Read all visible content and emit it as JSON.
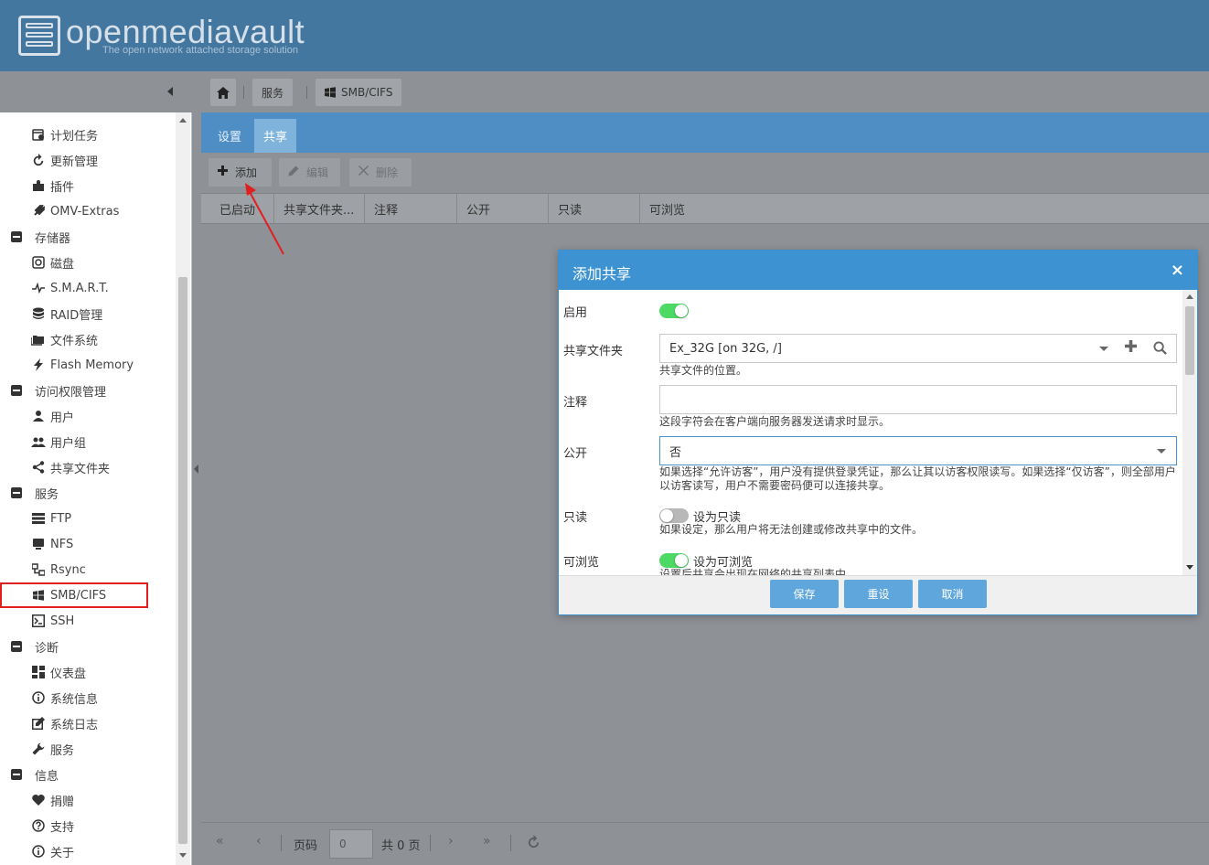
{
  "app": {
    "logo_text": "openmediavault",
    "logo_subtitle": "The open network attached storage solution"
  },
  "breadcrumb": {
    "items": [
      {
        "label": "服务"
      },
      {
        "label": "SMB/CIFS"
      }
    ]
  },
  "sidebar": {
    "items": [
      {
        "label": "计划任务",
        "icon": "calendar-clock-icon",
        "type": "child"
      },
      {
        "label": "更新管理",
        "icon": "refresh-icon",
        "type": "child"
      },
      {
        "label": "插件",
        "icon": "puzzle-icon",
        "type": "child"
      },
      {
        "label": "OMV-Extras",
        "icon": "plug-icon",
        "type": "child"
      },
      {
        "label": "存储器",
        "icon": "collapse-icon",
        "type": "group"
      },
      {
        "label": "磁盘",
        "icon": "disk-icon",
        "type": "child"
      },
      {
        "label": "S.M.A.R.T.",
        "icon": "pulse-icon",
        "type": "child"
      },
      {
        "label": "RAID管理",
        "icon": "database-icon",
        "type": "child"
      },
      {
        "label": "文件系统",
        "icon": "folders-icon",
        "type": "child"
      },
      {
        "label": "Flash Memory",
        "icon": "flash-icon",
        "type": "child"
      },
      {
        "label": "访问权限管理",
        "icon": "collapse-icon",
        "type": "group"
      },
      {
        "label": "用户",
        "icon": "user-icon",
        "type": "child"
      },
      {
        "label": "用户组",
        "icon": "users-icon",
        "type": "child"
      },
      {
        "label": "共享文件夹",
        "icon": "share-icon",
        "type": "child"
      },
      {
        "label": "服务",
        "icon": "collapse-icon",
        "type": "group"
      },
      {
        "label": "FTP",
        "icon": "server-icon",
        "type": "child"
      },
      {
        "label": "NFS",
        "icon": "monitor-icon",
        "type": "child"
      },
      {
        "label": "Rsync",
        "icon": "sync-icon",
        "type": "child"
      },
      {
        "label": "SMB/CIFS",
        "icon": "windows-icon",
        "type": "child"
      },
      {
        "label": "SSH",
        "icon": "terminal-icon",
        "type": "child"
      },
      {
        "label": "诊断",
        "icon": "collapse-icon",
        "type": "group"
      },
      {
        "label": "仪表盘",
        "icon": "dashboard-icon",
        "type": "child"
      },
      {
        "label": "系统信息",
        "icon": "info-icon",
        "type": "child"
      },
      {
        "label": "系统日志",
        "icon": "edit-icon",
        "type": "child"
      },
      {
        "label": "服务",
        "icon": "wrench-icon",
        "type": "child"
      },
      {
        "label": "信息",
        "icon": "collapse-icon",
        "type": "group"
      },
      {
        "label": "捐赠",
        "icon": "heart-icon",
        "type": "child"
      },
      {
        "label": "支持",
        "icon": "help-icon",
        "type": "child"
      },
      {
        "label": "关于",
        "icon": "info-icon",
        "type": "child"
      }
    ]
  },
  "tabs": [
    {
      "label": "设置"
    },
    {
      "label": "共享"
    }
  ],
  "toolbar": {
    "add_label": "添加",
    "edit_label": "编辑",
    "delete_label": "删除"
  },
  "grid": {
    "columns": [
      "已启动",
      "共享文件夹...",
      "注释",
      "公开",
      "只读",
      "可浏览"
    ]
  },
  "pager": {
    "page_label": "页码",
    "page_value": "0",
    "total_label": "共 0 页"
  },
  "dialog": {
    "title": "添加共享",
    "close": "×",
    "fields": {
      "enable": {
        "label": "启用"
      },
      "shared_folder": {
        "label": "共享文件夹",
        "value": "Ex_32G [on 32G, /]",
        "help": "共享文件的位置。"
      },
      "comment": {
        "label": "注释",
        "value": "",
        "help": "这段字符会在客户端向服务器发送请求时显示。"
      },
      "public": {
        "label": "公开",
        "value": "否",
        "help_line1": "如果选择“允许访客”，用户没有提供登录凭证，那么让其以访客权限读写。如果选择“仅访客”，则全部用户",
        "help_line2": "以访客读写，用户不需要密码便可以连接共享。"
      },
      "readonly": {
        "label": "只读",
        "toggle_label": "设为只读",
        "help": "如果设定，那么用户将无法创建或修改共享中的文件。"
      },
      "browseable": {
        "label": "可浏览",
        "toggle_label": "设为可浏览",
        "help": "设置后共享会出现在网络的共享列表中"
      }
    },
    "buttons": {
      "save": "保存",
      "reset": "重设",
      "cancel": "取消"
    }
  }
}
